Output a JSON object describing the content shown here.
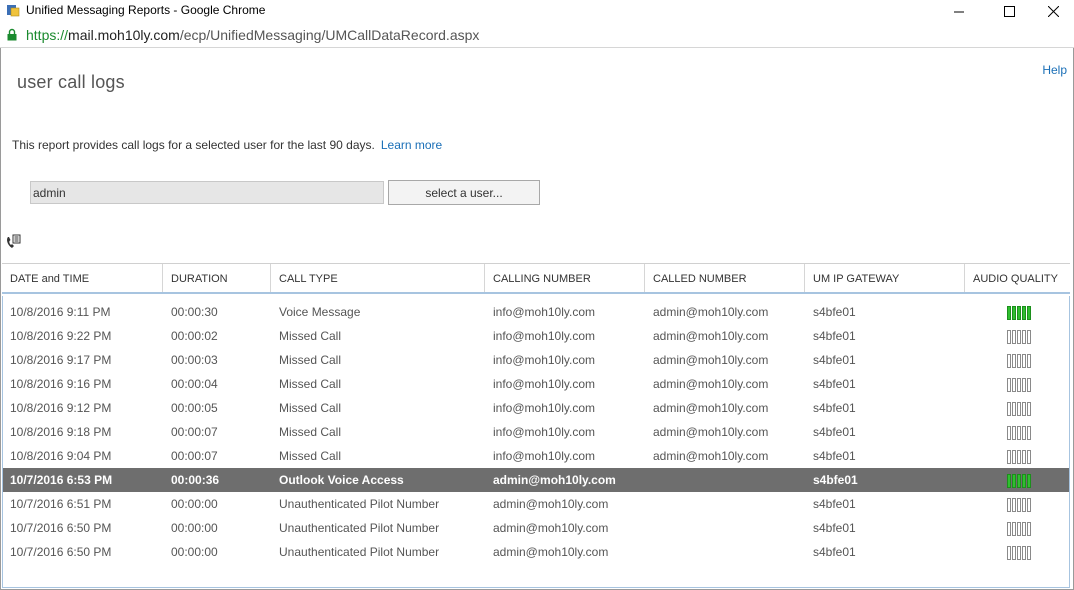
{
  "window": {
    "title": "Unified Messaging Reports - Google Chrome",
    "url_scheme": "https://",
    "url_host": "mail.moh10ly.com",
    "url_path": "/ecp/UnifiedMessaging/UMCallDataRecord.aspx"
  },
  "page": {
    "title": "user call logs",
    "help": "Help",
    "description": "This report provides call logs for a selected user for the last 90 days.",
    "learn_more": "Learn more"
  },
  "user_picker": {
    "value": "admin",
    "select_label": "select a user..."
  },
  "table": {
    "columns": [
      "DATE and TIME",
      "DURATION",
      "CALL TYPE",
      "CALLING NUMBER",
      "CALLED NUMBER",
      "UM IP GATEWAY",
      "AUDIO QUALITY"
    ],
    "rows": [
      {
        "date": "10/8/2016 9:11 PM",
        "duration": "00:00:30",
        "type": "Voice Message",
        "calling": "info@moh10ly.com",
        "called": "admin@moh10ly.com",
        "gateway": "s4bfe01",
        "quality_bars": 5
      },
      {
        "date": "10/8/2016 9:22 PM",
        "duration": "00:00:02",
        "type": "Missed Call",
        "calling": "info@moh10ly.com",
        "called": "admin@moh10ly.com",
        "gateway": "s4bfe01",
        "quality_bars": 0
      },
      {
        "date": "10/8/2016 9:17 PM",
        "duration": "00:00:03",
        "type": "Missed Call",
        "calling": "info@moh10ly.com",
        "called": "admin@moh10ly.com",
        "gateway": "s4bfe01",
        "quality_bars": 0
      },
      {
        "date": "10/8/2016 9:16 PM",
        "duration": "00:00:04",
        "type": "Missed Call",
        "calling": "info@moh10ly.com",
        "called": "admin@moh10ly.com",
        "gateway": "s4bfe01",
        "quality_bars": 0
      },
      {
        "date": "10/8/2016 9:12 PM",
        "duration": "00:00:05",
        "type": "Missed Call",
        "calling": "info@moh10ly.com",
        "called": "admin@moh10ly.com",
        "gateway": "s4bfe01",
        "quality_bars": 0
      },
      {
        "date": "10/8/2016 9:18 PM",
        "duration": "00:00:07",
        "type": "Missed Call",
        "calling": "info@moh10ly.com",
        "called": "admin@moh10ly.com",
        "gateway": "s4bfe01",
        "quality_bars": 0
      },
      {
        "date": "10/8/2016 9:04 PM",
        "duration": "00:00:07",
        "type": "Missed Call",
        "calling": "info@moh10ly.com",
        "called": "admin@moh10ly.com",
        "gateway": "s4bfe01",
        "quality_bars": 0
      },
      {
        "date": "10/7/2016 6:53 PM",
        "duration": "00:00:36",
        "type": "Outlook Voice Access",
        "calling": "admin@moh10ly.com",
        "called": "",
        "gateway": "s4bfe01",
        "quality_bars": 5,
        "selected": true
      },
      {
        "date": "10/7/2016 6:51 PM",
        "duration": "00:00:00",
        "type": "Unauthenticated Pilot Number",
        "calling": "admin@moh10ly.com",
        "called": "",
        "gateway": "s4bfe01",
        "quality_bars": 0
      },
      {
        "date": "10/7/2016 6:50 PM",
        "duration": "00:00:00",
        "type": "Unauthenticated Pilot Number",
        "calling": "admin@moh10ly.com",
        "called": "",
        "gateway": "s4bfe01",
        "quality_bars": 0
      },
      {
        "date": "10/7/2016 6:50 PM",
        "duration": "00:00:00",
        "type": "Unauthenticated Pilot Number",
        "calling": "admin@moh10ly.com",
        "called": "",
        "gateway": "s4bfe01",
        "quality_bars": 0
      }
    ]
  },
  "colors": {
    "link": "#1a6fb7",
    "secure_green": "#1a8a2e",
    "selected_row": "#6e6e6e",
    "quality_on": "#2fbf2f"
  },
  "icons": {
    "app": "exchange-icon",
    "lock": "lock-icon",
    "clear": "close-icon",
    "call_details": "phone-details-icon"
  }
}
